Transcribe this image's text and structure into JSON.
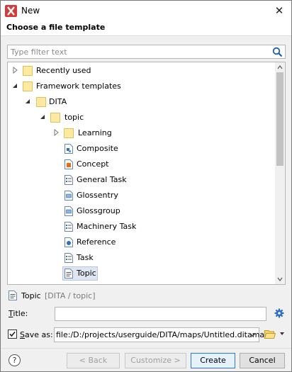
{
  "window": {
    "title": "New",
    "close_glyph": "✕",
    "accent": "#d13c3c"
  },
  "header": {
    "title": "Choose a file template"
  },
  "filter": {
    "placeholder": "Type filter text",
    "value": ""
  },
  "tree": {
    "items": [
      {
        "label": "Recently used",
        "type": "folder",
        "expander": "collapsed"
      },
      {
        "label": "Framework templates",
        "type": "folder",
        "expander": "expanded"
      },
      {
        "label": "DITA",
        "type": "folder",
        "expander": "expanded"
      },
      {
        "label": "topic",
        "type": "folder",
        "expander": "expanded"
      },
      {
        "label": "Learning",
        "type": "folder",
        "expander": "collapsed"
      },
      {
        "label": "Composite",
        "type": "document",
        "icon": "composite-doc-icon"
      },
      {
        "label": "Concept",
        "type": "document",
        "icon": "concept-doc-icon"
      },
      {
        "label": "General Task",
        "type": "document",
        "icon": "task-doc-icon"
      },
      {
        "label": "Glossentry",
        "type": "document",
        "icon": "glossary-doc-icon"
      },
      {
        "label": "Glossgroup",
        "type": "document",
        "icon": "glossary-doc-icon"
      },
      {
        "label": "Machinery Task",
        "type": "document",
        "icon": "task-doc-icon"
      },
      {
        "label": "Reference",
        "type": "document",
        "icon": "reference-doc-icon"
      },
      {
        "label": "Task",
        "type": "document",
        "icon": "task-doc-icon"
      },
      {
        "label": "Topic",
        "type": "document",
        "icon": "topic-doc-icon",
        "selected": true
      }
    ]
  },
  "summary": {
    "name": "Topic",
    "path": "[DITA / topic]"
  },
  "form": {
    "title_label_mnemonic": "T",
    "title_label_rest": "itle:",
    "title_value": "",
    "save_as_checked": true,
    "save_as_label_mnemonic": "S",
    "save_as_label_rest": "ave as:",
    "save_as_value": "file:/D:/projects/userguide/DITA/maps/Untitled.ditamap"
  },
  "footer": {
    "help_glyph": "?",
    "back_label": "< Back",
    "customize_label": "Customize >",
    "create_label": "Create",
    "cancel_label": "Cancel"
  }
}
